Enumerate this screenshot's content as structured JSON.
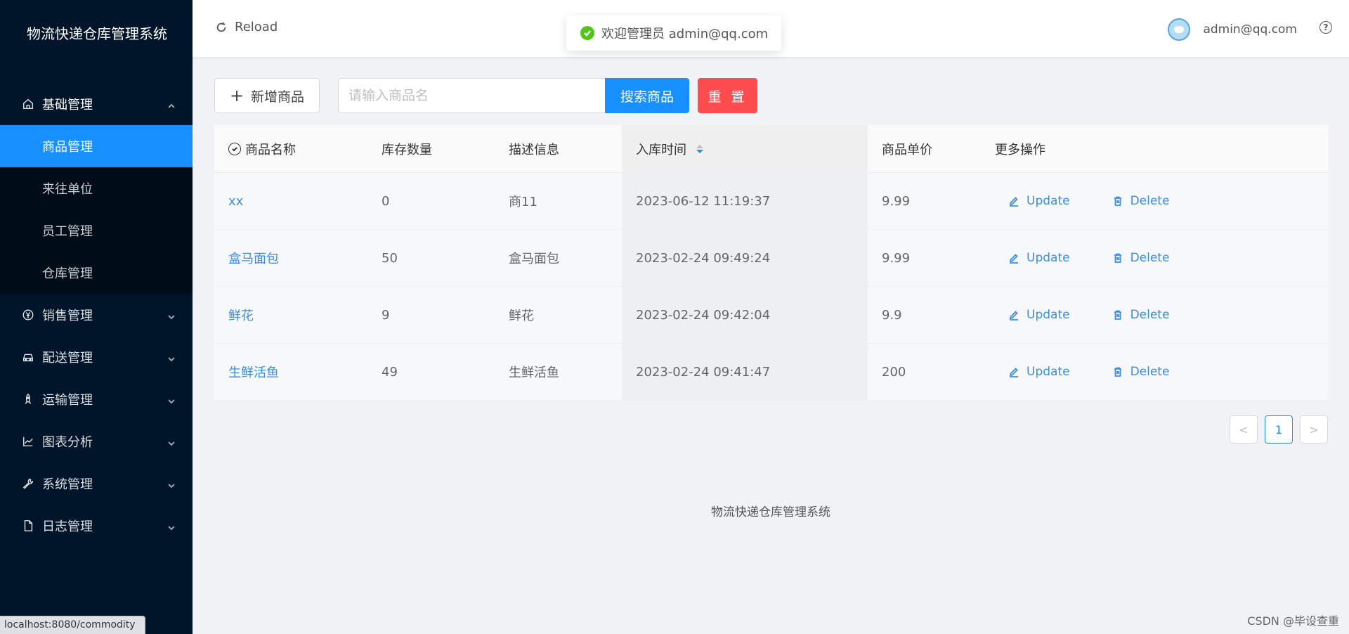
{
  "sidebar": {
    "brand": "物流快递仓库管理系统",
    "group_basic": "基础管理",
    "sub_items": [
      "商品管理",
      "来往单位",
      "员工管理",
      "仓库管理"
    ],
    "groups": [
      "销售管理",
      "配送管理",
      "运输管理",
      "图表分析",
      "系统管理",
      "日志管理"
    ]
  },
  "status_url": "localhost:8080/commodity",
  "header": {
    "reload": "Reload",
    "user": "admin@qq.com"
  },
  "toast": "欢迎管理员 admin@qq.com",
  "toolbar": {
    "add_label": "新增商品",
    "search_placeholder": "请输入商品名",
    "search_label": "搜索商品",
    "reset_label": "重 置"
  },
  "table": {
    "headers": [
      "商品名称",
      "库存数量",
      "描述信息",
      "入库时间",
      "商品单价",
      "更多操作"
    ],
    "update_label": "Update",
    "delete_label": "Delete",
    "rows": [
      {
        "name": "xx",
        "stock": "0",
        "desc": "商11",
        "time": "2023-06-12 11:19:37",
        "price": "9.99"
      },
      {
        "name": "盒马面包",
        "stock": "50",
        "desc": "盒马面包",
        "time": "2023-02-24 09:49:24",
        "price": "9.99"
      },
      {
        "name": "鲜花",
        "stock": "9",
        "desc": "鲜花",
        "time": "2023-02-24 09:42:04",
        "price": "9.9"
      },
      {
        "name": "生鲜活鱼",
        "stock": "49",
        "desc": "生鲜活鱼",
        "time": "2023-02-24 09:41:47",
        "price": "200"
      }
    ]
  },
  "pagination": {
    "current": "1",
    "prev": "<",
    "next": ">"
  },
  "footer": "物流快递仓库管理系统",
  "watermark": "CSDN @毕设查重",
  "colors": {
    "primary": "#1890ff",
    "danger": "#ff4d4f",
    "sidebar": "#001529",
    "success": "#52c41a"
  }
}
